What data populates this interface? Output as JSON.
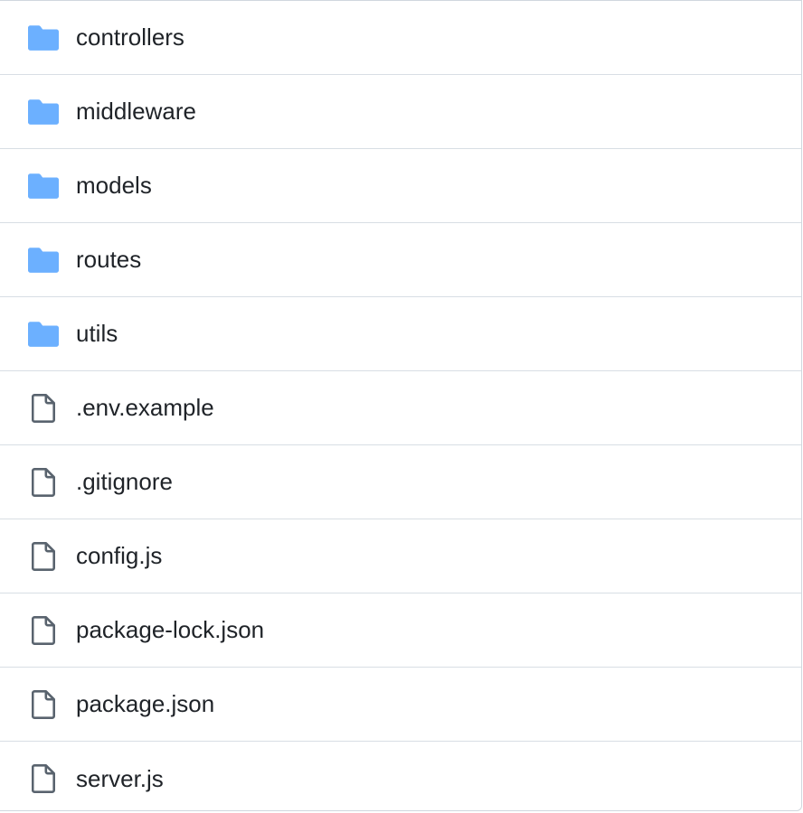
{
  "colors": {
    "folder_icon": "#6cb0ff",
    "file_icon": "#59636e",
    "text": "#1f2328",
    "divider": "#d8dee4"
  },
  "entries": [
    {
      "name": "controllers",
      "type": "folder",
      "icon": "folder-icon"
    },
    {
      "name": "middleware",
      "type": "folder",
      "icon": "folder-icon"
    },
    {
      "name": "models",
      "type": "folder",
      "icon": "folder-icon"
    },
    {
      "name": "routes",
      "type": "folder",
      "icon": "folder-icon"
    },
    {
      "name": "utils",
      "type": "folder",
      "icon": "folder-icon"
    },
    {
      "name": ".env.example",
      "type": "file",
      "icon": "file-icon"
    },
    {
      "name": ".gitignore",
      "type": "file",
      "icon": "file-icon"
    },
    {
      "name": "config.js",
      "type": "file",
      "icon": "file-icon"
    },
    {
      "name": "package-lock.json",
      "type": "file",
      "icon": "file-icon"
    },
    {
      "name": "package.json",
      "type": "file",
      "icon": "file-icon"
    },
    {
      "name": "server.js",
      "type": "file",
      "icon": "file-icon"
    }
  ]
}
